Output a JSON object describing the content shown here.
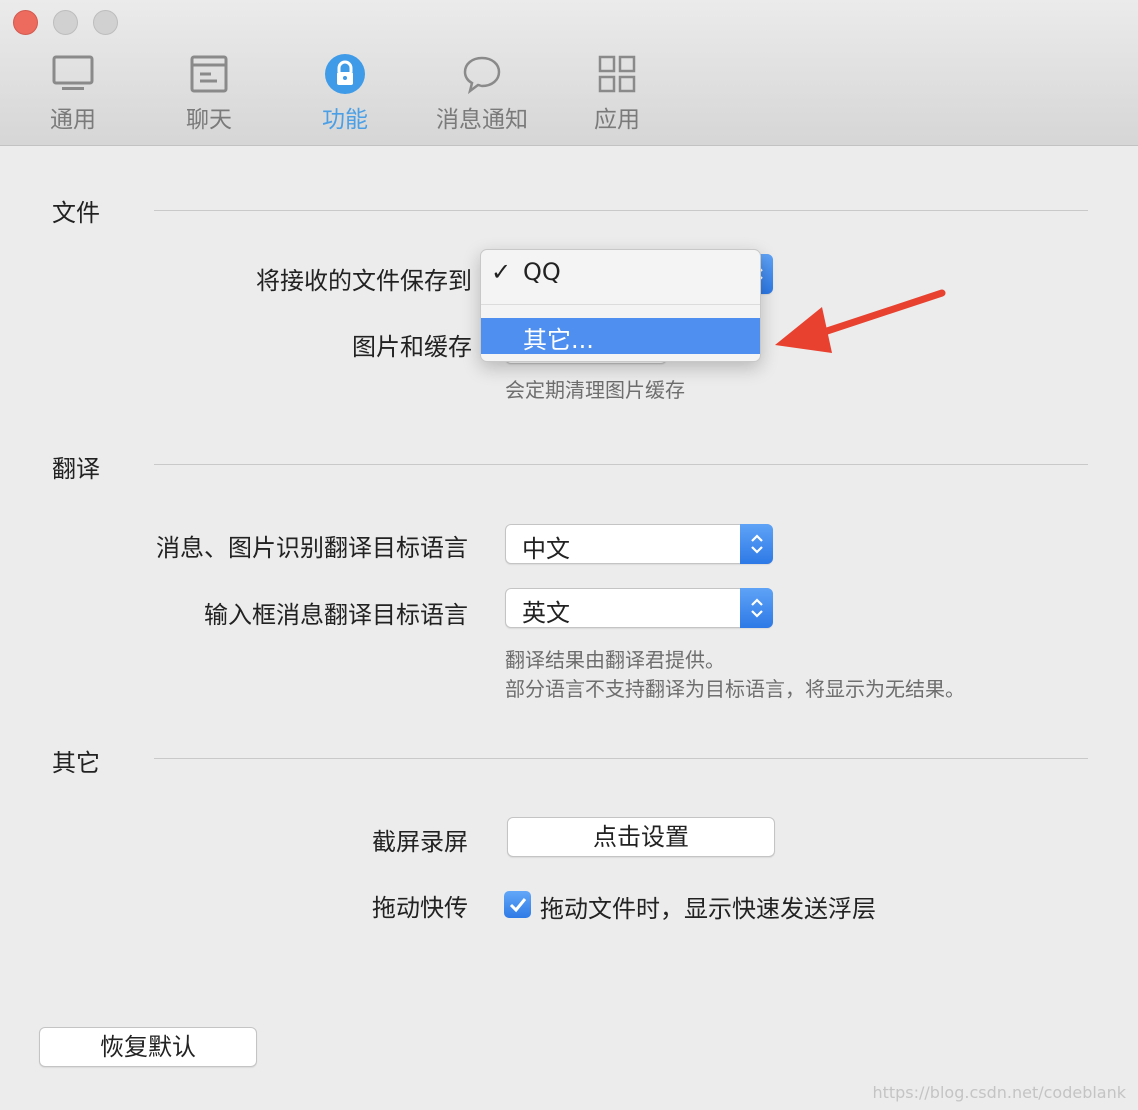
{
  "tabs": [
    {
      "label": "通用",
      "icon": "monitor-icon"
    },
    {
      "label": "聊天",
      "icon": "chat-window-icon"
    },
    {
      "label": "功能",
      "icon": "lock-icon"
    },
    {
      "label": "消息通知",
      "icon": "speech-bubble-icon"
    },
    {
      "label": "应用",
      "icon": "grid-icon"
    }
  ],
  "active_tab": "功能",
  "accent_color": "#4a9fe6",
  "file_section": {
    "title": "文件",
    "save_to_label": "将接收的文件保存到",
    "images_cache_label": "图片和缓存",
    "cache_hint": "会定期清理图片缓存"
  },
  "dropdown": {
    "options": [
      {
        "label": "QQ",
        "checked": true
      },
      {
        "label": "其它...",
        "highlighted": true
      }
    ]
  },
  "translate_section": {
    "title": "翻译",
    "msg_image_label": "消息、图片识别翻译目标语言",
    "msg_image_value": "中文",
    "input_label": "输入框消息翻译目标语言",
    "input_value": "英文",
    "hint_line1": "翻译结果由翻译君提供。",
    "hint_line2": "部分语言不支持翻译为目标语言，将显示为无结果。"
  },
  "other_section": {
    "title": "其它",
    "screenshot_label": "截屏录屏",
    "screenshot_button": "点击设置",
    "drag_label": "拖动快传",
    "drag_checkbox_text": "拖动文件时，显示快速发送浮层",
    "drag_checked": true
  },
  "restore_button": "恢复默认",
  "watermark": "https://blog.csdn.net/codeblank"
}
